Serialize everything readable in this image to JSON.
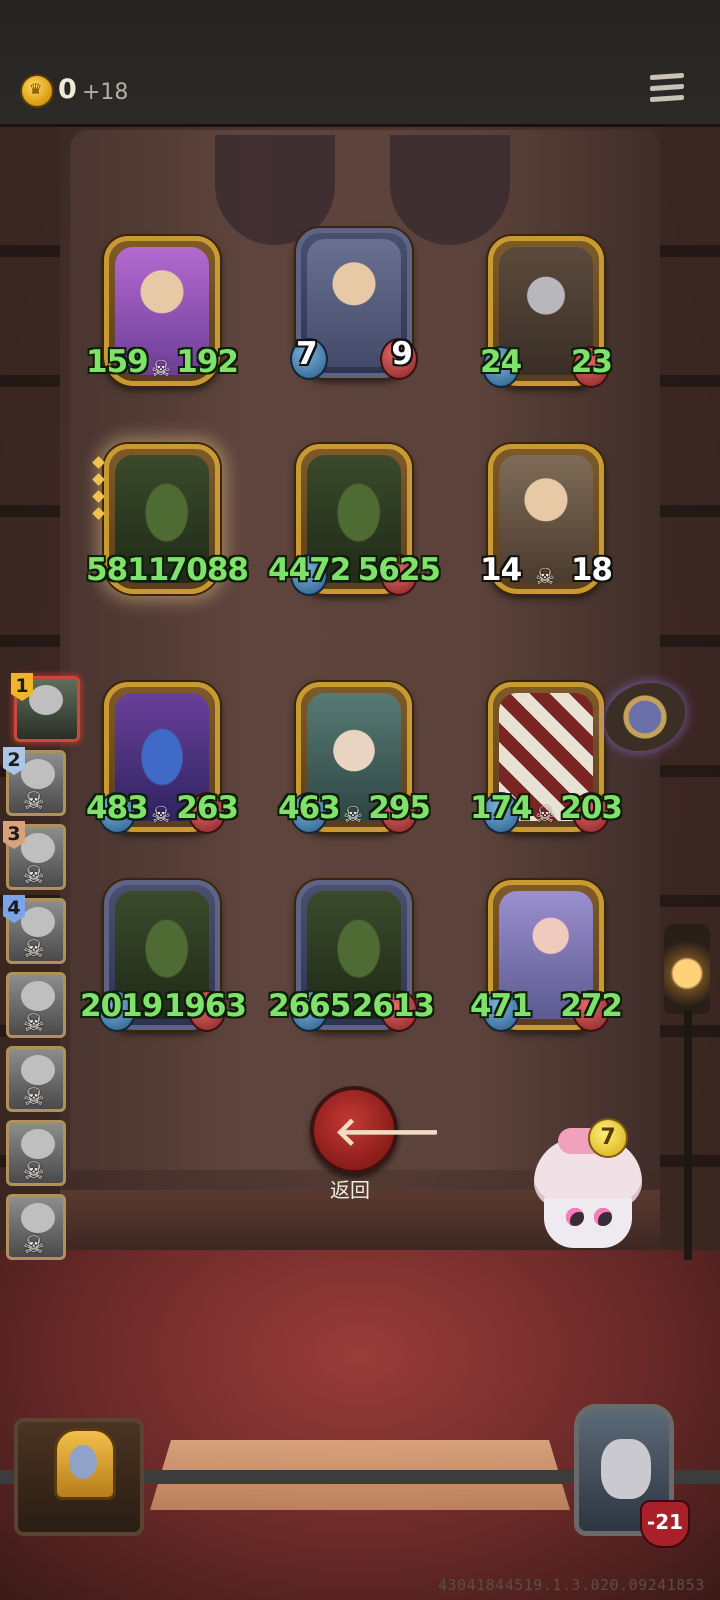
{
  "header": {
    "coins": "0",
    "coin_income": "+18"
  },
  "board": {
    "minions": [
      {
        "name": "grandma-minion",
        "attack": "159",
        "health": "192"
      },
      {
        "name": "grandma-minion",
        "attack": "7",
        "health": "9"
      },
      {
        "name": "knight-minion",
        "attack": "24",
        "health": "23"
      },
      {
        "name": "dragon-minion-golden",
        "attack": "5811",
        "health": "7088"
      },
      {
        "name": "dragon-minion",
        "attack": "4472",
        "health": "5625"
      },
      {
        "name": "grandma-minion",
        "attack": "14",
        "health": "18"
      },
      {
        "name": "blue-dragon-minion",
        "attack": "483",
        "health": "263"
      },
      {
        "name": "old-man-minion",
        "attack": "463",
        "health": "295"
      },
      {
        "name": "ace-card-minion",
        "attack": "174",
        "health": "203"
      },
      {
        "name": "dragon-minion",
        "attack": "2019",
        "health": "1963"
      },
      {
        "name": "dragon-minion",
        "attack": "2665",
        "health": "2613"
      },
      {
        "name": "harpist-minion",
        "attack": "471",
        "health": "272"
      }
    ]
  },
  "leaderboard": {
    "ranks": [
      "1",
      "2",
      "3",
      "4"
    ]
  },
  "controls": {
    "back_label": "返回",
    "cupcake_count": "7"
  },
  "player": {
    "health_delta": "-21"
  },
  "footer": {
    "version": "43041844519.1.3.020.09241853"
  },
  "colors": {
    "stat_green": "#7fe26b",
    "gold_frame": "#c99a32",
    "silver_frame": "#5e6487",
    "back_button": "#c43a34"
  }
}
